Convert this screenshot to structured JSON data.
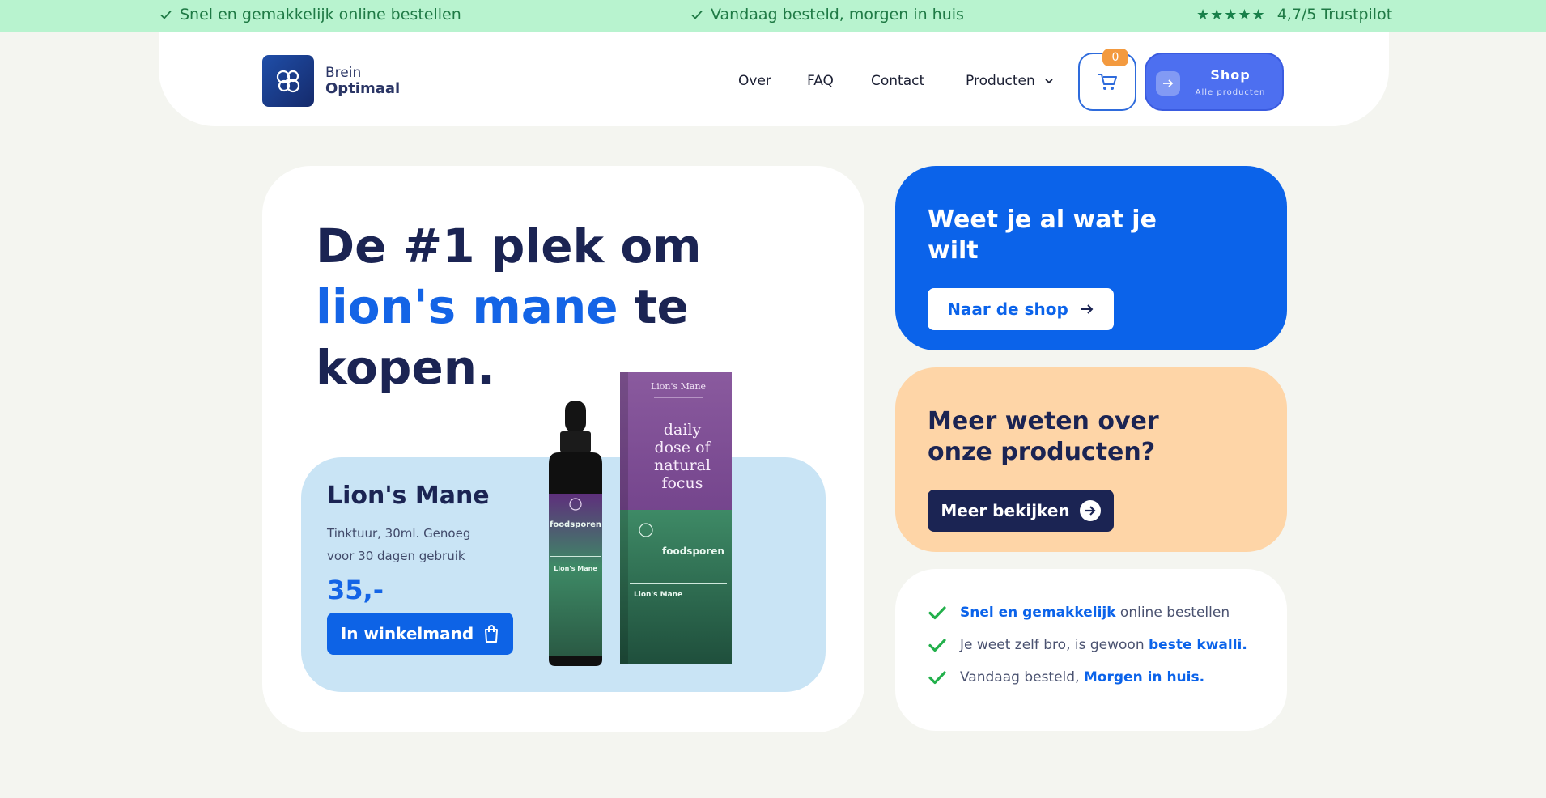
{
  "topbar": {
    "item1": "Snel en gemakkelijk online bestellen",
    "item2": "Vandaag besteld, morgen in huis",
    "stars": "★★★★★",
    "rating": "4,7/5 Trustpilot",
    "color": "#b8f3cf"
  },
  "header": {
    "logo_line1": "Brein",
    "logo_line2": "Optimaal",
    "nav": [
      "Over",
      "FAQ",
      "Contact",
      "Producten"
    ],
    "cart_count": "0",
    "shop_label": "Shop",
    "shop_sub": "Alle producten"
  },
  "hero": {
    "title_part1": "De #1 plek om",
    "title_highlight": "lion's mane",
    "title_part2": " te",
    "title_part3": "kopen.",
    "product": {
      "name": "Lion's Mane",
      "description": "Tinktuur, 30ml. Genoeg voor 30 dagen gebruik",
      "price": "35,-",
      "button": "In winkelmand"
    },
    "image": {
      "bottle_brand": "foodsporen",
      "bottle_name": "Lion's Mane",
      "box_top": "Lion's Mane",
      "box_tagline_1": "daily",
      "box_tagline_2": "dose of",
      "box_tagline_3": "natural",
      "box_tagline_4": "focus"
    }
  },
  "cards": {
    "blue": {
      "title": "Weet je al wat je wilt",
      "button": "Naar de shop",
      "color": "#0b63ea"
    },
    "orange": {
      "title": "Meer weten over onze producten?",
      "button": "Meer bekijken",
      "color": "#fed5a7"
    },
    "usps": [
      {
        "bold": "Snel en gemakkelijk",
        "rest": " online bestellen"
      },
      {
        "rest": "Je weet zelf bro, is gewoon ",
        "bold": "beste kwalli."
      },
      {
        "rest": "Vandaag besteld, ",
        "bold": "Morgen in huis."
      }
    ]
  },
  "colors": {
    "navy": "#1b2453",
    "accent": "#1464e6",
    "background": "#f4f5f0"
  }
}
